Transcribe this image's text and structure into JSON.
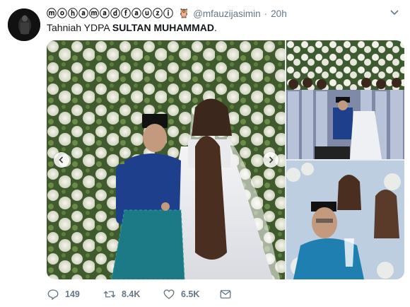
{
  "tweet": {
    "display_name_glyphs": "ⓜⓞⓗⓐⓜⓐⓓⓕⓐⓤⓩⓘ",
    "handle": "@mfauzijasimin",
    "separator": "·",
    "time": "20h",
    "text_prefix": "Tahniah YDPA ",
    "text_bold": "SULTAN MUHAMMAD",
    "text_suffix": "."
  },
  "actions": {
    "reply_count": "149",
    "retweet_count": "8.4K",
    "like_count": "6.5K"
  },
  "colors": {
    "text_primary": "#14171a",
    "text_secondary": "#657786",
    "background": "#ffffff"
  },
  "icons": [
    "owl-emoji-icon",
    "chevron-down-icon",
    "chevron-left-icon",
    "chevron-right-icon",
    "reply-icon",
    "retweet-icon",
    "like-icon",
    "direct-message-icon"
  ]
}
